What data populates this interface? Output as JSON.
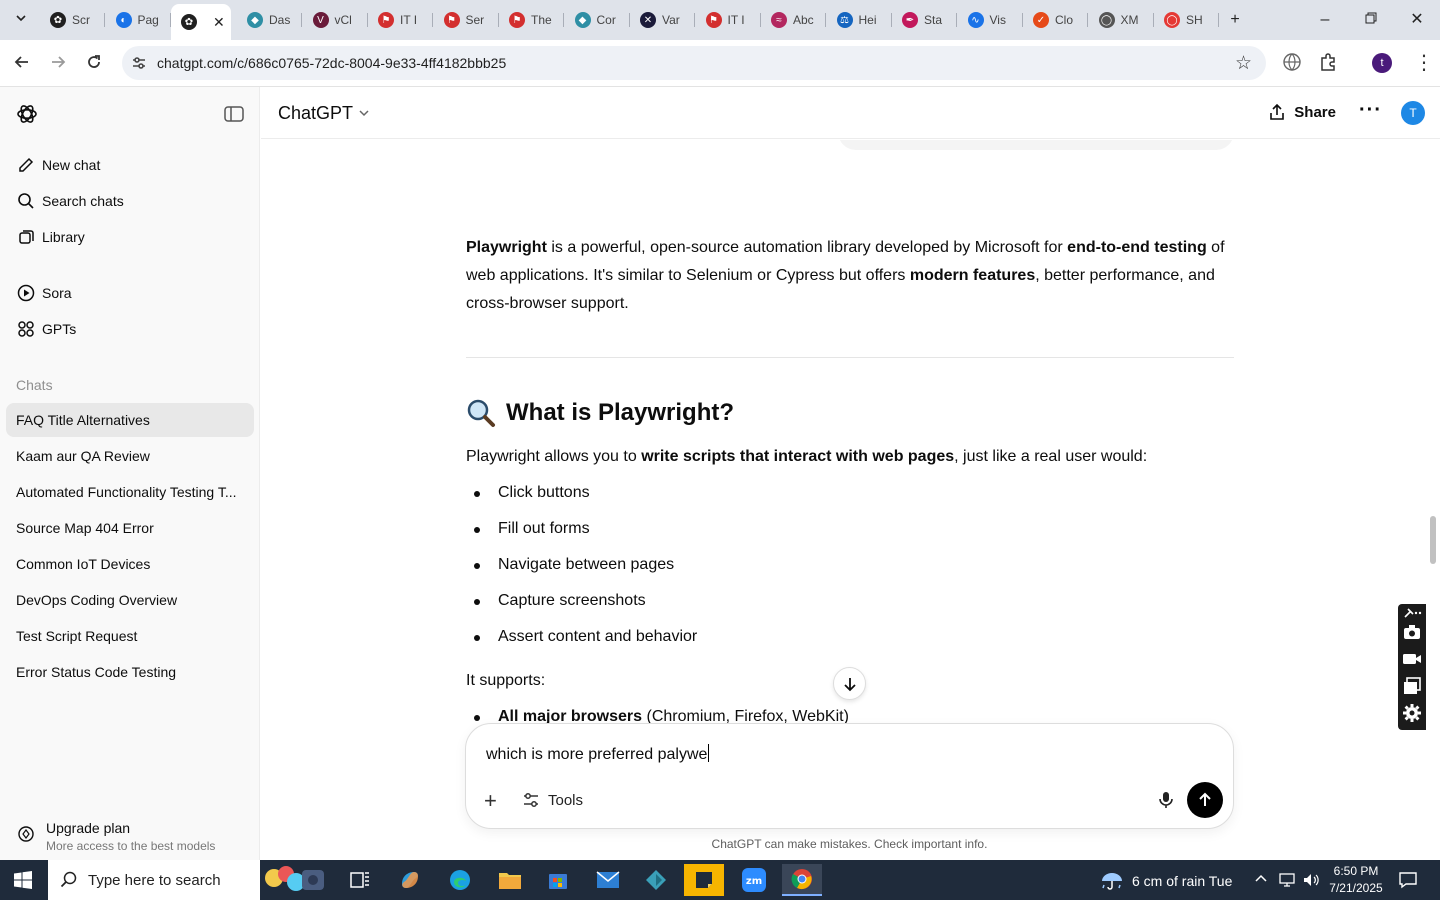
{
  "browser": {
    "tabs": [
      {
        "label": "Scr",
        "icon": "chatgpt-icon",
        "color": "#202020"
      },
      {
        "label": "Pag",
        "icon": "speedometer-icon",
        "color": "#1a73e8"
      },
      {
        "label": "",
        "icon": "chatgpt-icon",
        "color": "#202020",
        "active": true
      },
      {
        "label": "Das",
        "icon": "shield-icon",
        "color": "#2f8fa5"
      },
      {
        "label": "vCl",
        "icon": "v-logo-icon",
        "color": "#6a1b3a"
      },
      {
        "label": "IT I",
        "icon": "ticket-icon",
        "color": "#d32f2f"
      },
      {
        "label": "Ser",
        "icon": "ticket-icon",
        "color": "#d32f2f"
      },
      {
        "label": "The",
        "icon": "ticket-icon",
        "color": "#d32f2f"
      },
      {
        "label": "Cor",
        "icon": "shield-icon",
        "color": "#2f8fa5"
      },
      {
        "label": "Var",
        "icon": "x-logo-icon",
        "color": "#1b1b3a"
      },
      {
        "label": "IT I",
        "icon": "ticket-icon",
        "color": "#d32f2f"
      },
      {
        "label": "Abc",
        "icon": "wave-icon",
        "color": "#b3275f"
      },
      {
        "label": "Hei",
        "icon": "scale-icon",
        "color": "#1565c0"
      },
      {
        "label": "Sta",
        "icon": "pen-icon",
        "color": "#c2185b"
      },
      {
        "label": "Vis",
        "icon": "pulse-icon",
        "color": "#1a73e8"
      },
      {
        "label": "Clo",
        "icon": "claude-icon",
        "color": "#e64a19"
      },
      {
        "label": "XM",
        "icon": "globe-icon",
        "color": "#555555"
      },
      {
        "label": "SH",
        "icon": "ring-icon",
        "color": "#e53935"
      }
    ],
    "url": "chatgpt.com/c/686c0765-72dc-8004-9e33-4ff4182bbb25",
    "profile_initial": "t"
  },
  "sidebar": {
    "nav": [
      {
        "label": "New chat",
        "icon": "compose-icon"
      },
      {
        "label": "Search chats",
        "icon": "search-icon"
      },
      {
        "label": "Library",
        "icon": "library-icon"
      },
      {
        "label": "Sora",
        "icon": "play-circle-icon"
      },
      {
        "label": "GPTs",
        "icon": "grid-icon"
      }
    ],
    "section_label": "Chats",
    "chats": [
      "FAQ Title Alternatives",
      "Kaam aur QA Review",
      "Automated Functionality Testing T...",
      "Source Map 404 Error",
      "Common IoT Devices",
      "DevOps Coding Overview",
      "Test Script Request",
      "Error Status Code Testing"
    ],
    "upgrade_title": "Upgrade plan",
    "upgrade_subtitle": "More access to the best models"
  },
  "header": {
    "model": "ChatGPT",
    "share": "Share",
    "avatar_initial": "T"
  },
  "message": {
    "intro_p1_bold1": "Playwright",
    "intro_p1_t1": " is a powerful, open-source automation library developed by Microsoft for ",
    "intro_p1_bold2": "end-to-end testing",
    "intro_p1_t2": " of web applications. It's similar to Selenium or Cypress but offers ",
    "intro_p1_bold3": "modern features",
    "intro_p1_t3": ", better performance, and cross-browser support.",
    "h2": "What is Playwright?",
    "p2_t1": "Playwright allows you to ",
    "p2_bold": "write scripts that interact with web pages",
    "p2_t2": ", just like a real user would:",
    "bullets": [
      "Click buttons",
      "Fill out forms",
      "Navigate between pages",
      "Capture screenshots",
      "Assert content and behavior"
    ],
    "supports": "It supports:",
    "support_bold": "All major browsers",
    "support_rest": " (Chromium, Firefox, WebKit)"
  },
  "composer": {
    "value": "which is more preferred palywe",
    "tools": "Tools",
    "disclaimer": "ChatGPT can make mistakes. Check important info."
  },
  "taskbar": {
    "search_placeholder": "Type here to search",
    "weather": "6 cm of rain Tue",
    "time": "6:50 PM",
    "date": "7/21/2025"
  }
}
